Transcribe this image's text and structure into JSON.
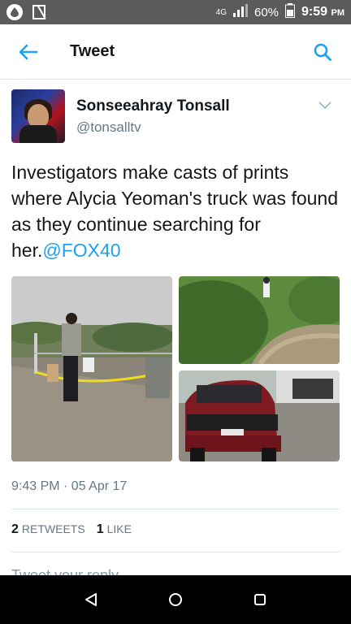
{
  "status_bar": {
    "battery": "60%",
    "time": "9:59",
    "ampm": "PM",
    "network": "4G"
  },
  "app_bar": {
    "title": "Tweet"
  },
  "tweet": {
    "author_name": "Sonseeahray Tonsall",
    "author_handle": "@tonsalltv",
    "text": "Investigators make casts of prints where Alycia Yeoman's truck was found as they continue searching for her.",
    "mention": "@FOX40",
    "timestamp": "9:43 PM · 05 Apr 17",
    "retweets_count": "2",
    "retweets_label": "RETWEETS",
    "likes_count": "1",
    "likes_label": "LIKE",
    "reply_placeholder": "Tweet your reply"
  },
  "colors": {
    "accent": "#1da1f2",
    "status_bar": "#5b5b5b",
    "nav_bar": "#000000"
  }
}
